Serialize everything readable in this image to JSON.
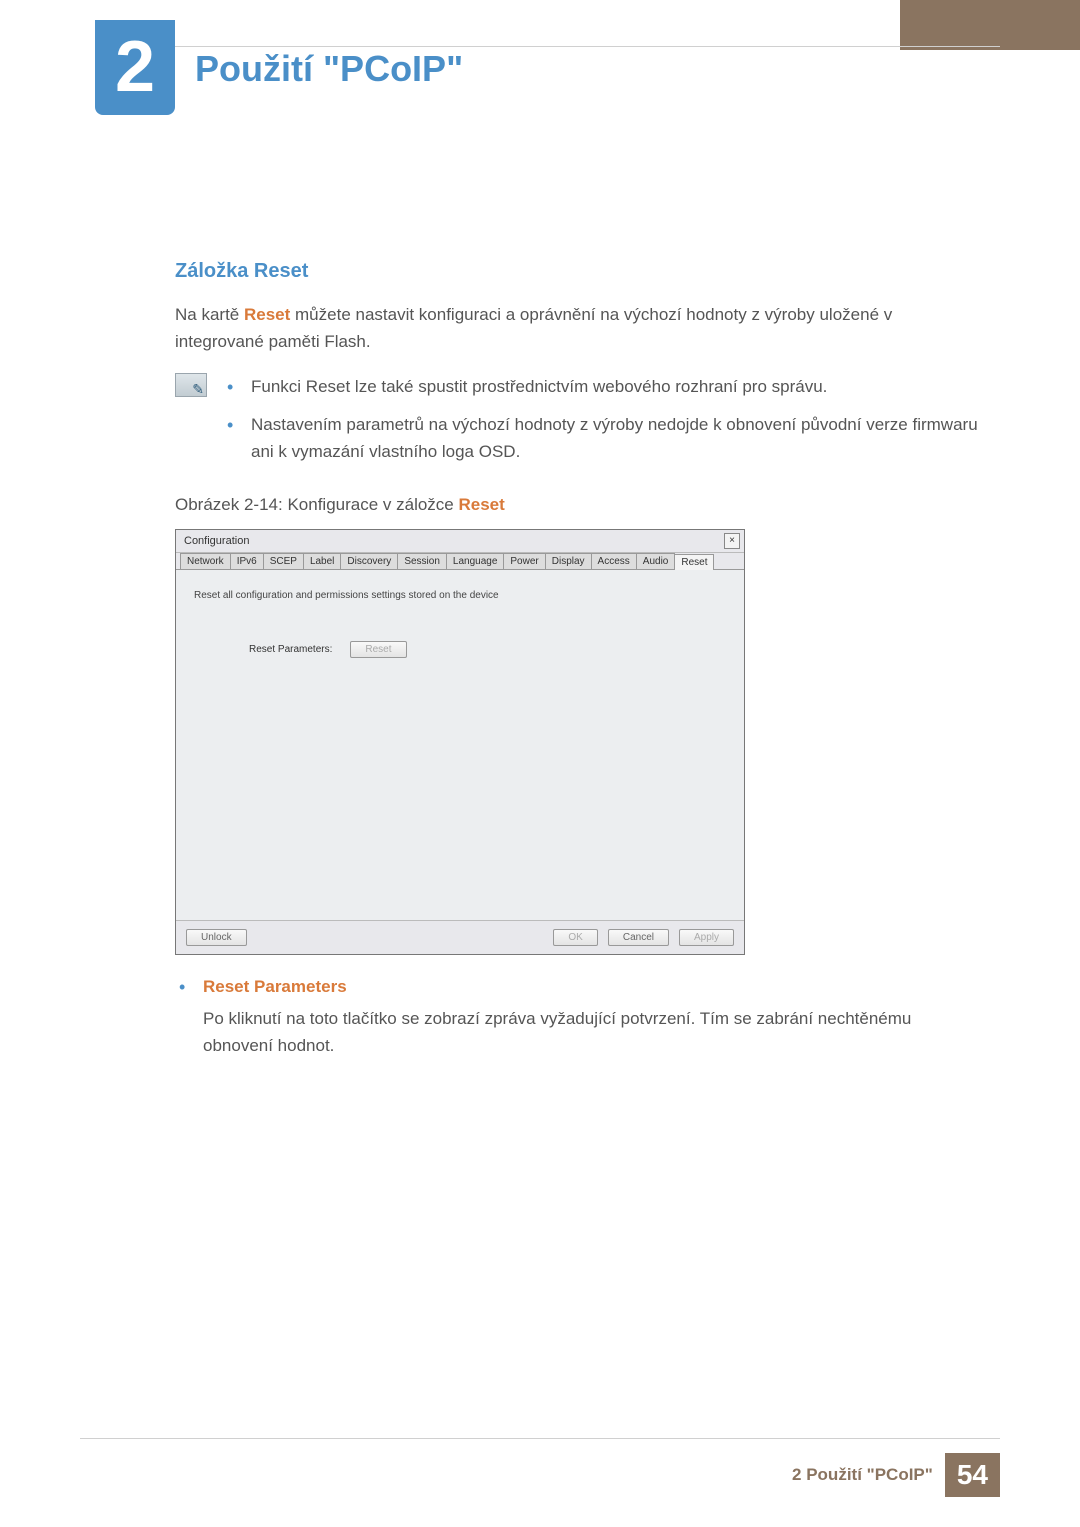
{
  "chapter_number": "2",
  "page_title": "Použití \"PCoIP\"",
  "section_heading": "Záložka Reset",
  "intro_text_prefix": "Na kartě ",
  "intro_text_highlight": "Reset",
  "intro_text_suffix": " můžete nastavit konfiguraci a oprávnění na výchozí hodnoty z výroby uložené v integrované paměti Flash.",
  "note_items": [
    "Funkci Reset lze také spustit prostřednictvím webového rozhraní pro správu.",
    "Nastavením parametrů na výchozí hodnoty z výroby nedojde k obnovení původní verze firmwaru ani k vymazání vlastního loga OSD."
  ],
  "figure_caption_prefix": "Obrázek 2-14: Konfigurace v záložce ",
  "figure_caption_highlight": "Reset",
  "config_window": {
    "title": "Configuration",
    "close": "×",
    "tabs": [
      "Network",
      "IPv6",
      "SCEP",
      "Label",
      "Discovery",
      "Session",
      "Language",
      "Power",
      "Display",
      "Access",
      "Audio",
      "Reset"
    ],
    "active_tab_index": 11,
    "desc": "Reset all configuration and permissions settings stored on the device",
    "row_label": "Reset Parameters:",
    "reset_btn": "Reset",
    "unlock_btn": "Unlock",
    "ok_btn": "OK",
    "cancel_btn": "Cancel",
    "apply_btn": "Apply"
  },
  "sub_bullet_title": "Reset Parameters",
  "sub_bullet_text": "Po kliknutí na toto tlačítko se zobrazí zpráva vyžadující potvrzení. Tím se zabrání nechtěnému obnovení hodnot.",
  "footer_text": "2 Použití \"PCoIP\"",
  "footer_page": "54"
}
